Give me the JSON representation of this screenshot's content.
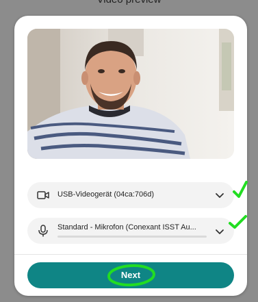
{
  "top_caption": "Video preview",
  "devices": {
    "camera": {
      "icon": "video-camera-icon",
      "label": "USB-Videogerät (04ca:706d)"
    },
    "microphone": {
      "icon": "microphone-icon",
      "label": "Standard - Mikrofon (Conexant ISST Au..."
    }
  },
  "actions": {
    "next_label": "Next"
  },
  "colors": {
    "accent": "#0f8585",
    "annotation": "#22dd22",
    "backdrop": "#8c8c8c"
  }
}
